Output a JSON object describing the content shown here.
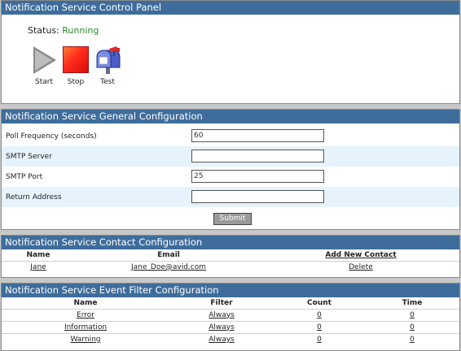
{
  "control_panel": {
    "title": "Notification Service Control Panel",
    "status_label": "Status:",
    "status_value": "Running",
    "status_color": "#2a8a2a",
    "buttons": [
      {
        "label": "Start",
        "icon": "play-icon"
      },
      {
        "label": "Stop",
        "icon": "stop-icon"
      },
      {
        "label": "Test",
        "icon": "mailbox-icon"
      }
    ]
  },
  "general_config": {
    "title": "Notification Service General Configuration",
    "fields": [
      {
        "label": "Poll Frequency (seconds)",
        "value": "60"
      },
      {
        "label": "SMTP Server",
        "value": ""
      },
      {
        "label": "SMTP Port",
        "value": "25"
      },
      {
        "label": "Return Address",
        "value": ""
      }
    ],
    "submit_label": "Submit"
  },
  "contact_config": {
    "title": "Notification Service Contact Configuration",
    "headers": {
      "name": "Name",
      "email": "Email",
      "add": "Add New Contact"
    },
    "rows": [
      {
        "name": "Jane",
        "email": "Jane_Doe@avid.com",
        "action": "Delete"
      }
    ]
  },
  "event_filter_config": {
    "title": "Notification Service Event Filter Configuration",
    "headers": {
      "name": "Name",
      "filter": "Filter",
      "count": "Count",
      "time": "Time"
    },
    "rows": [
      {
        "name": "Error",
        "filter": "Always",
        "count": "0",
        "time": "0"
      },
      {
        "name": "Information",
        "filter": "Always",
        "count": "0",
        "time": "0"
      },
      {
        "name": "Warning",
        "filter": "Always",
        "count": "0",
        "time": "0"
      }
    ]
  },
  "colors": {
    "header_bg": "#3e6d9c",
    "alt_row_bg": "#e6f3fc",
    "page_bg": "#c8c8c8"
  }
}
